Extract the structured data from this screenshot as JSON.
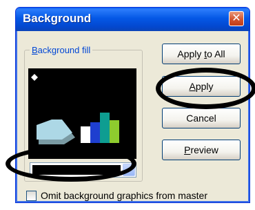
{
  "window": {
    "title": "Background",
    "close_glyph": "✕"
  },
  "fill_group": {
    "label_prefix": "",
    "label_accel": "B",
    "label_rest": "ackground fill",
    "color_arrow_glyph": "▼"
  },
  "buttons": {
    "apply_all": {
      "pre": "Apply ",
      "accel": "t",
      "post": "o All"
    },
    "apply": {
      "pre": "",
      "accel": "A",
      "post": "pply"
    },
    "cancel": {
      "pre": "Cancel",
      "accel": "",
      "post": ""
    },
    "preview": {
      "pre": "",
      "accel": "P",
      "post": "review"
    }
  },
  "omit_option": {
    "checked": false,
    "label_pre": "Omit background ",
    "label_accel": "g",
    "label_post": "raphics from master"
  },
  "colors": {
    "title_bar": "#0458e6",
    "dialog_bg": "#ece9d8",
    "preview_bg": "#000000",
    "shape_light_blue": "#add8e6",
    "bar_blue": "#1e3fcf",
    "bar_teal": "#0e9d91",
    "bar_green": "#8ecb2e",
    "annotation_ellipse": "#000000"
  }
}
